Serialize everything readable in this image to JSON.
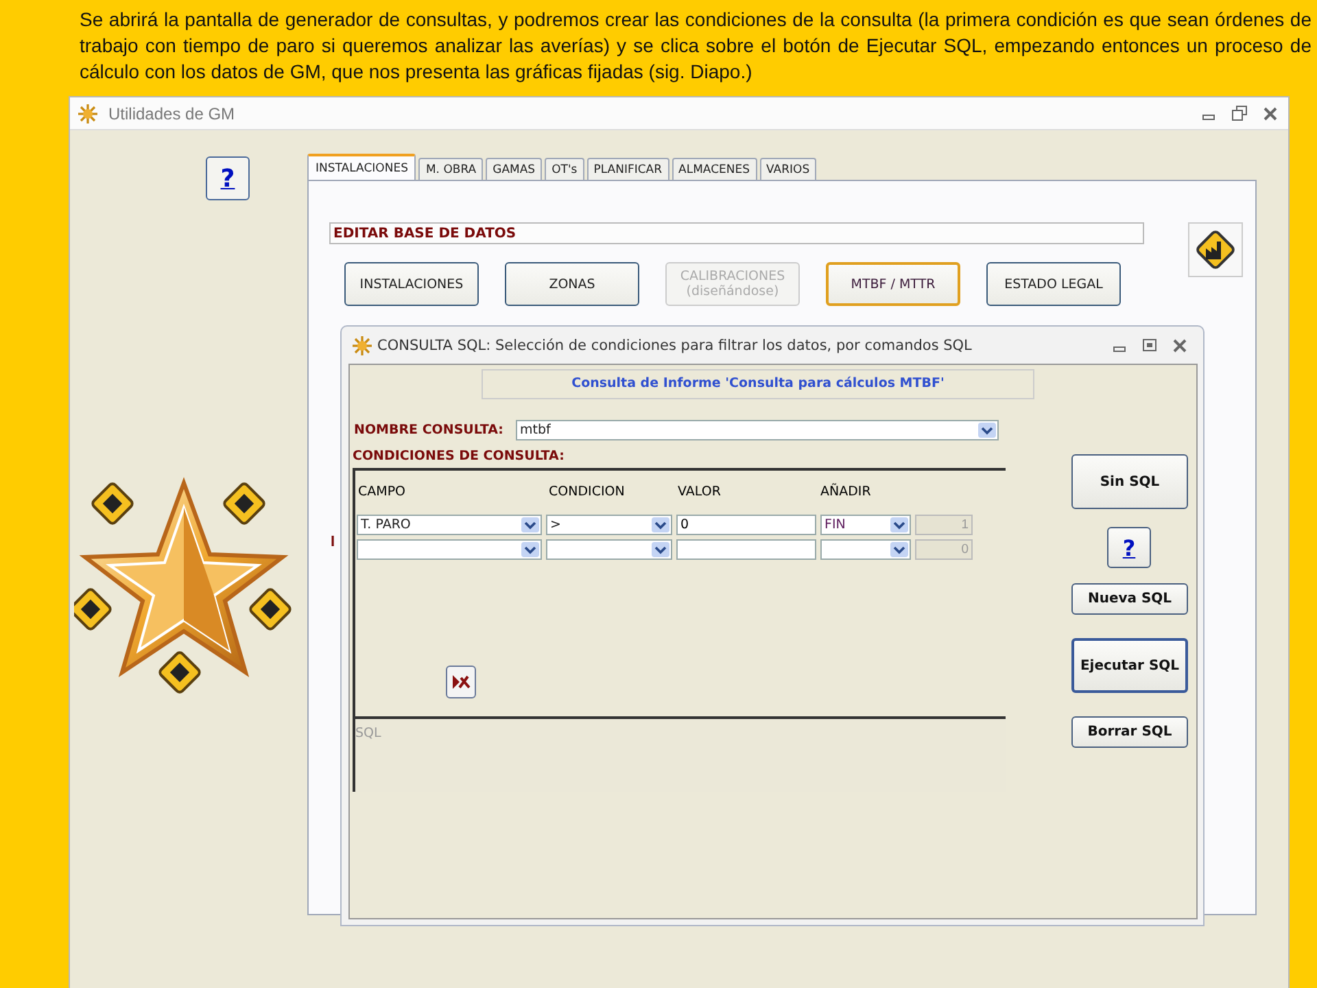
{
  "caption": "Se abrirá la pantalla de generador de consultas, y podremos crear las condiciones de la consulta (la primera condición es que sean órdenes de trabajo con tiempo de paro si queremos analizar las averías) y se clica sobre el botón de Ejecutar SQL, empezando entonces un proceso de cálculo con los datos de GM, que nos presenta las gráficas fijadas (sig. Diapo.)",
  "window": {
    "title": "Utilidades de GM"
  },
  "help_button": "?",
  "tabs": [
    {
      "label": "INSTALACIONES",
      "selected": true
    },
    {
      "label": "M. OBRA",
      "selected": false
    },
    {
      "label": "GAMAS",
      "selected": false
    },
    {
      "label": "OT's",
      "selected": false
    },
    {
      "label": "PLANIFICAR",
      "selected": false
    },
    {
      "label": "ALMACENES",
      "selected": false
    },
    {
      "label": "VARIOS",
      "selected": false
    }
  ],
  "section_label": "EDITAR BASE DE DATOS",
  "section_buttons": [
    {
      "label": "INSTALACIONES",
      "disabled": false,
      "selected": false
    },
    {
      "label": "ZONAS",
      "disabled": false,
      "selected": false
    },
    {
      "label": "CALIBRACIONES",
      "sublabel": "(diseñándose)",
      "disabled": true,
      "selected": false
    },
    {
      "label": "MTBF / MTTR",
      "disabled": false,
      "selected": true
    },
    {
      "label": "ESTADO LEGAL",
      "disabled": false,
      "selected": false
    }
  ],
  "hidden_label": "I",
  "dialog": {
    "title": "CONSULTA SQL: Selección de condiciones para filtrar los datos, por comandos SQL",
    "header": "Consulta de Informe 'Consulta para cálculos MTBF'",
    "name_label": "NOMBRE CONSULTA:",
    "name_value": "mtbf",
    "conditions_label": "CONDICIONES DE CONSULTA:",
    "columns": [
      "CAMPO",
      "CONDICION",
      "VALOR",
      "AÑADIR"
    ],
    "rows": [
      {
        "campo": "T. PARO",
        "condicion": ">",
        "valor": "0",
        "anadir": "FIN",
        "number": "1"
      },
      {
        "number": "0"
      }
    ],
    "sql_placeholder": "SQL",
    "buttons": [
      {
        "label": "Sin SQL",
        "kind": "large"
      },
      {
        "label": "?",
        "kind": "help"
      },
      {
        "label": "Nueva SQL",
        "kind": "small"
      },
      {
        "label": "Ejecutar SQL",
        "kind": "default"
      },
      {
        "label": "Borrar SQL",
        "kind": "small"
      }
    ]
  }
}
